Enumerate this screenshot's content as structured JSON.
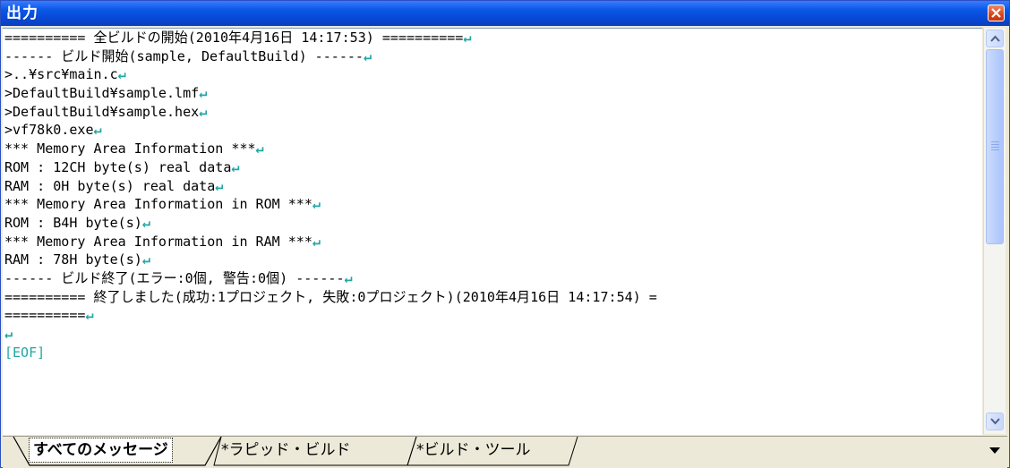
{
  "window": {
    "title": "出力"
  },
  "output": {
    "lines": [
      "========== 全ビルドの開始(2010年4月16日 14:17:53) ==========",
      "------ ビルド開始(sample, DefaultBuild) ------",
      ">..¥src¥main.c",
      ">DefaultBuild¥sample.lmf",
      ">DefaultBuild¥sample.hex",
      ">vf78k0.exe",
      "*** Memory Area Information ***",
      "ROM : 12CH byte(s) real data",
      "RAM : 0H byte(s) real data",
      "*** Memory Area Information in ROM ***",
      "ROM : B4H byte(s)",
      "*** Memory Area Information in RAM ***",
      "RAM : 78H byte(s)",
      "------ ビルド終了(エラー:0個, 警告:0個) ------",
      "========== 終了しました(成功:1プロジェクト, 失敗:0プロジェクト)(2010年4月16日 14:17:54) =",
      "==========",
      ""
    ],
    "eof_marker": "[EOF]",
    "newline_glyph": "↵"
  },
  "tabs": [
    {
      "label": "すべてのメッセージ",
      "active": true
    },
    {
      "label": "*ラピッド・ビルド",
      "active": false
    },
    {
      "label": "*ビルド・ツール",
      "active": false
    }
  ],
  "colors": {
    "titlebar": "#0a58e8",
    "newline_marker": "#21a6a6",
    "close_button": "#d8451c"
  }
}
